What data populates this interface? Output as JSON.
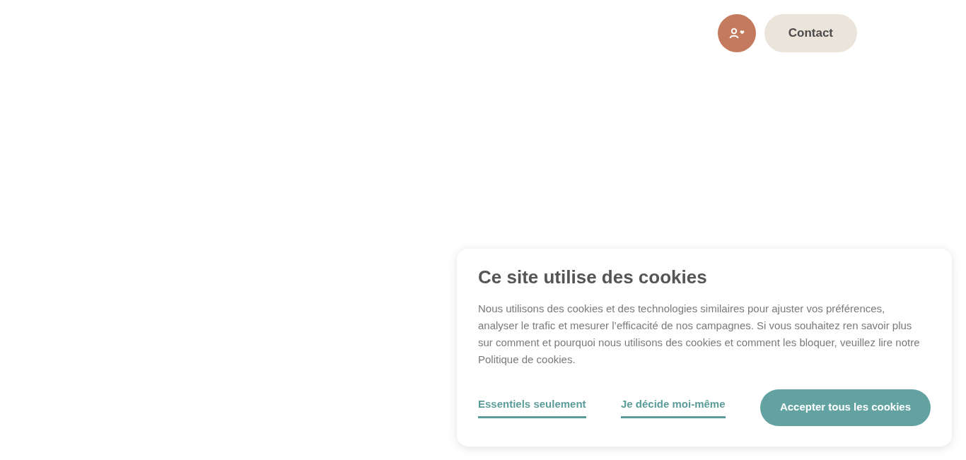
{
  "header": {
    "contact_button": "Contact"
  },
  "cookie_banner": {
    "title": "Ce site utilise des cookies",
    "text": "Nous utilisons des cookies et des technologies similaires pour ajuster vos préférences, analyser le trafic et mesurer l’efficacité de nos campagnes. Si vous souhaitez ren savoir plus sur comment et pourquoi nous utilisons des cookies et comment les bloquer, veuillez lire notre Politique de cookies.",
    "actions": [
      {
        "label": "Essentiels seulement",
        "kind": "link"
      },
      {
        "label": "Je décide moi-même",
        "kind": "link"
      },
      {
        "label": "Accepter tous les cookies",
        "kind": "button"
      }
    ]
  }
}
